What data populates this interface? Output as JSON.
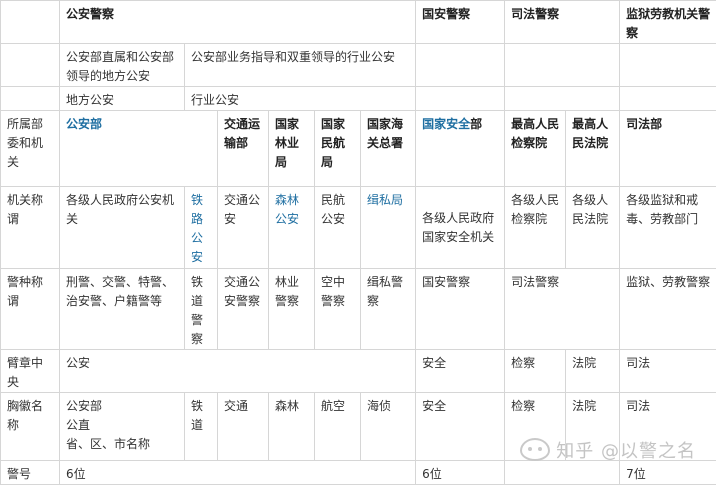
{
  "header": {
    "gongan": "公安警察",
    "guoan": "国安警察",
    "sifa": "司法警察",
    "jianyu": "监狱劳教机关警察"
  },
  "row2": {
    "direct": "公安部直属和公安部领导的地方公安",
    "industry": "公安部业务指导和双重领导的行业公安"
  },
  "row3": {
    "local": "地方公安",
    "industry": "行业公安"
  },
  "dept": {
    "label": "所属部委和机关",
    "mps": "公安部",
    "traffic": "交通运输部",
    "forest": "国家林业局",
    "aviation": "国家民航局",
    "customs": "国家海关总署",
    "mss_a": "国家安全",
    "mss_b": "部",
    "procuratorate": "最高人民检察院",
    "court": "最高人民法院",
    "justice": "司法部"
  },
  "org": {
    "label": "机关称谓",
    "local": "各级人民政府公安机关",
    "railway": "铁路公安",
    "traffic": "交通公安",
    "forest": "森林公安",
    "aviation": "民航公安",
    "customs": "缉私局",
    "mss": "各级人民政府国家安全机关",
    "procuratorate": "各级人民检察院",
    "court": "各级人民法院",
    "justice": "各级监狱和戒毒、劳教部门"
  },
  "police": {
    "label": "警种称谓",
    "local": "刑警、交警、特警、治安警、户籍警等",
    "railway": "铁道警察",
    "traffic": "交通公安警察",
    "forest": "林业警察",
    "aviation": "空中警察",
    "customs": "缉私警察",
    "mss": "国安警察",
    "judicial": "司法警察",
    "prison": "监狱、劳教警察"
  },
  "armband": {
    "label": "臂章中央",
    "gongan": "公安",
    "mss": "安全",
    "procuratorate": "检察",
    "court": "法院",
    "justice": "司法"
  },
  "badge": {
    "label": "胸徽名称",
    "local_1": "公安部",
    "local_2": "公直",
    "local_3": "省、区、市名称",
    "railway": "铁道",
    "traffic": "交通",
    "forest": "森林",
    "aviation": "航空",
    "customs": "海侦",
    "mss": "安全",
    "procuratorate": "检察",
    "court": "法院",
    "justice": "司法"
  },
  "number": {
    "label": "警号",
    "gongan": "6位",
    "mss": "6位",
    "justice": "7位"
  },
  "watermark": {
    "text": "知乎 @以警之名"
  }
}
